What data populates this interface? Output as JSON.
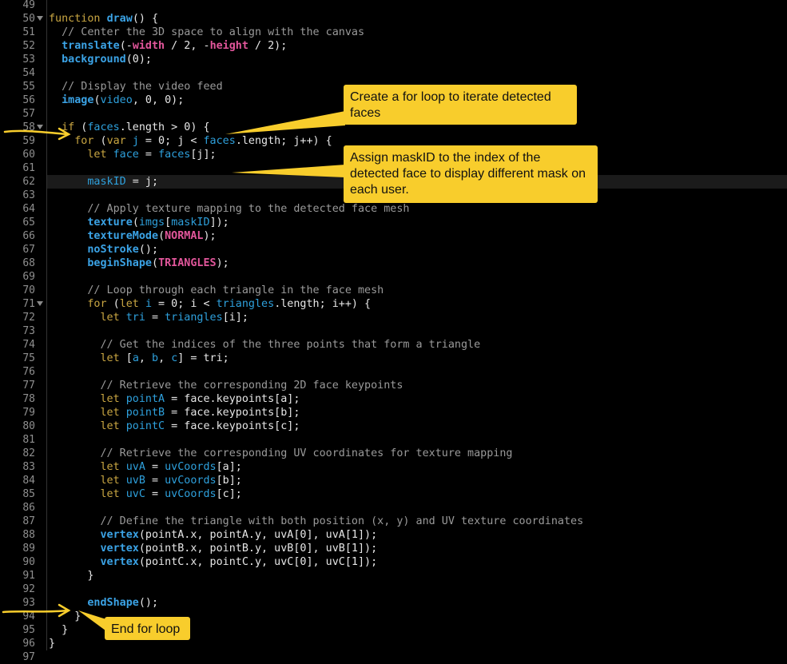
{
  "gutter": {
    "line_numbers": [
      "49",
      "50",
      "51",
      "52",
      "53",
      "54",
      "55",
      "56",
      "57",
      "58",
      "59",
      "60",
      "61",
      "62",
      "63",
      "64",
      "65",
      "66",
      "67",
      "68",
      "69",
      "70",
      "71",
      "72",
      "73",
      "74",
      "75",
      "76",
      "77",
      "78",
      "79",
      "80",
      "81",
      "82",
      "83",
      "84",
      "85",
      "86",
      "87",
      "88",
      "89",
      "90",
      "91",
      "92",
      "93",
      "94",
      "95",
      "96",
      "97"
    ],
    "fold_lines": [
      "50",
      "58",
      "71"
    ]
  },
  "code": {
    "highlighted_line": "62",
    "lines": [
      [],
      [
        [
          "k",
          "function "
        ],
        [
          "f",
          "draw"
        ],
        [
          "p",
          "() {"
        ]
      ],
      [
        [
          "c",
          "  // Center the 3D space to align with the canvas"
        ]
      ],
      [
        [
          "p",
          "  "
        ],
        [
          "f",
          "translate"
        ],
        [
          "p",
          "(-"
        ],
        [
          "s",
          "width"
        ],
        [
          "p",
          " / 2, -"
        ],
        [
          "s",
          "height"
        ],
        [
          "p",
          " / 2);"
        ]
      ],
      [
        [
          "p",
          "  "
        ],
        [
          "f",
          "background"
        ],
        [
          "p",
          "(0);"
        ]
      ],
      [],
      [
        [
          "c",
          "  // Display the video feed"
        ]
      ],
      [
        [
          "p",
          "  "
        ],
        [
          "f",
          "image"
        ],
        [
          "p",
          "("
        ],
        [
          "v",
          "video"
        ],
        [
          "p",
          ", 0, 0);"
        ]
      ],
      [],
      [
        [
          "p",
          "  "
        ],
        [
          "k",
          "if"
        ],
        [
          "p",
          " ("
        ],
        [
          "v",
          "faces"
        ],
        [
          "p",
          ".length > 0) {"
        ]
      ],
      [
        [
          "p",
          "    "
        ],
        [
          "k",
          "for"
        ],
        [
          "p",
          " ("
        ],
        [
          "k",
          "var"
        ],
        [
          "p",
          " "
        ],
        [
          "v",
          "j"
        ],
        [
          "p",
          " = 0; j < "
        ],
        [
          "v",
          "faces"
        ],
        [
          "p",
          ".length; j++) {"
        ]
      ],
      [
        [
          "p",
          "      "
        ],
        [
          "k",
          "let"
        ],
        [
          "p",
          " "
        ],
        [
          "v",
          "face"
        ],
        [
          "p",
          " = "
        ],
        [
          "v",
          "faces"
        ],
        [
          "p",
          "[j];"
        ]
      ],
      [],
      [
        [
          "p",
          "      "
        ],
        [
          "v",
          "maskID"
        ],
        [
          "p",
          " = j;"
        ]
      ],
      [],
      [
        [
          "c",
          "      // Apply texture mapping to the detected face mesh"
        ]
      ],
      [
        [
          "p",
          "      "
        ],
        [
          "f",
          "texture"
        ],
        [
          "p",
          "("
        ],
        [
          "v",
          "imgs"
        ],
        [
          "p",
          "["
        ],
        [
          "v",
          "maskID"
        ],
        [
          "p",
          "]);"
        ]
      ],
      [
        [
          "p",
          "      "
        ],
        [
          "f",
          "textureMode"
        ],
        [
          "p",
          "("
        ],
        [
          "s",
          "NORMAL"
        ],
        [
          "p",
          ");"
        ]
      ],
      [
        [
          "p",
          "      "
        ],
        [
          "f",
          "noStroke"
        ],
        [
          "p",
          "();"
        ]
      ],
      [
        [
          "p",
          "      "
        ],
        [
          "f",
          "beginShape"
        ],
        [
          "p",
          "("
        ],
        [
          "s",
          "TRIANGLES"
        ],
        [
          "p",
          ");"
        ]
      ],
      [],
      [
        [
          "c",
          "      // Loop through each triangle in the face mesh"
        ]
      ],
      [
        [
          "p",
          "      "
        ],
        [
          "k",
          "for"
        ],
        [
          "p",
          " ("
        ],
        [
          "k",
          "let"
        ],
        [
          "p",
          " "
        ],
        [
          "v",
          "i"
        ],
        [
          "p",
          " = 0; i < "
        ],
        [
          "v",
          "triangles"
        ],
        [
          "p",
          ".length; i++) {"
        ]
      ],
      [
        [
          "p",
          "        "
        ],
        [
          "k",
          "let"
        ],
        [
          "p",
          " "
        ],
        [
          "v",
          "tri"
        ],
        [
          "p",
          " = "
        ],
        [
          "v",
          "triangles"
        ],
        [
          "p",
          "[i];"
        ]
      ],
      [],
      [
        [
          "c",
          "        // Get the indices of the three points that form a triangle"
        ]
      ],
      [
        [
          "p",
          "        "
        ],
        [
          "k",
          "let"
        ],
        [
          "p",
          " ["
        ],
        [
          "v",
          "a"
        ],
        [
          "p",
          ", "
        ],
        [
          "v",
          "b"
        ],
        [
          "p",
          ", "
        ],
        [
          "v",
          "c"
        ],
        [
          "p",
          "] = tri;"
        ]
      ],
      [],
      [
        [
          "c",
          "        // Retrieve the corresponding 2D face keypoints"
        ]
      ],
      [
        [
          "p",
          "        "
        ],
        [
          "k",
          "let"
        ],
        [
          "p",
          " "
        ],
        [
          "v",
          "pointA"
        ],
        [
          "p",
          " = face.keypoints[a];"
        ]
      ],
      [
        [
          "p",
          "        "
        ],
        [
          "k",
          "let"
        ],
        [
          "p",
          " "
        ],
        [
          "v",
          "pointB"
        ],
        [
          "p",
          " = face.keypoints[b];"
        ]
      ],
      [
        [
          "p",
          "        "
        ],
        [
          "k",
          "let"
        ],
        [
          "p",
          " "
        ],
        [
          "v",
          "pointC"
        ],
        [
          "p",
          " = face.keypoints[c];"
        ]
      ],
      [],
      [
        [
          "c",
          "        // Retrieve the corresponding UV coordinates for texture mapping"
        ]
      ],
      [
        [
          "p",
          "        "
        ],
        [
          "k",
          "let"
        ],
        [
          "p",
          " "
        ],
        [
          "v",
          "uvA"
        ],
        [
          "p",
          " = "
        ],
        [
          "v",
          "uvCoords"
        ],
        [
          "p",
          "[a];"
        ]
      ],
      [
        [
          "p",
          "        "
        ],
        [
          "k",
          "let"
        ],
        [
          "p",
          " "
        ],
        [
          "v",
          "uvB"
        ],
        [
          "p",
          " = "
        ],
        [
          "v",
          "uvCoords"
        ],
        [
          "p",
          "[b];"
        ]
      ],
      [
        [
          "p",
          "        "
        ],
        [
          "k",
          "let"
        ],
        [
          "p",
          " "
        ],
        [
          "v",
          "uvC"
        ],
        [
          "p",
          " = "
        ],
        [
          "v",
          "uvCoords"
        ],
        [
          "p",
          "[c];"
        ]
      ],
      [],
      [
        [
          "c",
          "        // Define the triangle with both position (x, y) and UV texture coordinates"
        ]
      ],
      [
        [
          "p",
          "        "
        ],
        [
          "f",
          "vertex"
        ],
        [
          "p",
          "(pointA.x, pointA.y, uvA[0], uvA[1]);"
        ]
      ],
      [
        [
          "p",
          "        "
        ],
        [
          "f",
          "vertex"
        ],
        [
          "p",
          "(pointB.x, pointB.y, uvB[0], uvB[1]);"
        ]
      ],
      [
        [
          "p",
          "        "
        ],
        [
          "f",
          "vertex"
        ],
        [
          "p",
          "(pointC.x, pointC.y, uvC[0], uvC[1]);"
        ]
      ],
      [
        [
          "p",
          "      }"
        ]
      ],
      [],
      [
        [
          "p",
          "      "
        ],
        [
          "f",
          "endShape"
        ],
        [
          "p",
          "();"
        ]
      ],
      [
        [
          "p",
          "    }"
        ]
      ],
      [
        [
          "p",
          "  }"
        ]
      ],
      [
        [
          "p",
          "}"
        ]
      ],
      []
    ]
  },
  "annotations": {
    "color": "#f8cd2c",
    "callout_for_loop": "Create a for loop to iterate detected faces",
    "callout_mask_id": "Assign maskID to the index of the detected face to display different mask on each user.",
    "callout_end_loop": "End for loop"
  },
  "syntax_colors": {
    "keyword": "#c9a642",
    "function": "#3ba3e6",
    "variable": "#2ea0dc",
    "comment": "#9a9a9a",
    "constant": "#e2569b",
    "plain": "#e6e6e6",
    "background": "#000000"
  }
}
